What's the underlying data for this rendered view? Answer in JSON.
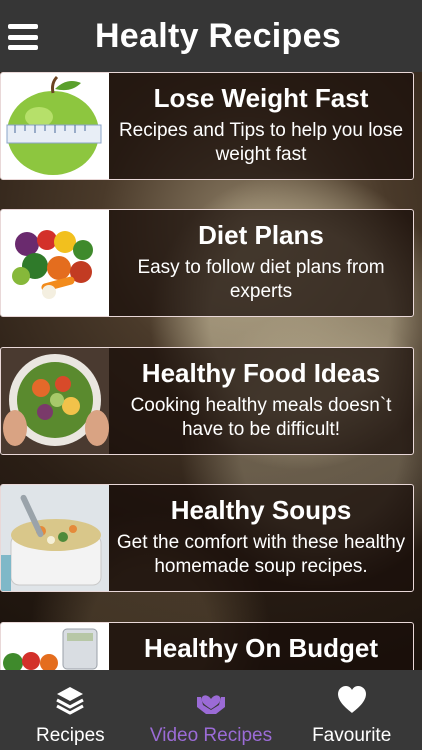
{
  "header": {
    "title": "Healty Recipes"
  },
  "cards": [
    {
      "title": "Lose Weight Fast",
      "description": "Recipes and Tips to help you lose weight fast"
    },
    {
      "title": "Diet Plans",
      "description": "Easy to follow diet plans from experts"
    },
    {
      "title": "Healthy Food Ideas",
      "description": "Cooking healthy meals doesn`t have to be difficult!"
    },
    {
      "title": "Healthy Soups",
      "description": "Get the comfort with these healthy homemade soup recipes."
    },
    {
      "title": "Healthy On Budget",
      "description": ""
    }
  ],
  "tabbar": {
    "tabs": [
      {
        "label": "Recipes",
        "icon": "layers-icon"
      },
      {
        "label": "Video Recipes",
        "icon": "heart-hands-icon"
      },
      {
        "label": "Favourite",
        "icon": "heart-icon"
      }
    ],
    "active_tab": "Video Recipes",
    "active_color": "#9b6bd6"
  }
}
